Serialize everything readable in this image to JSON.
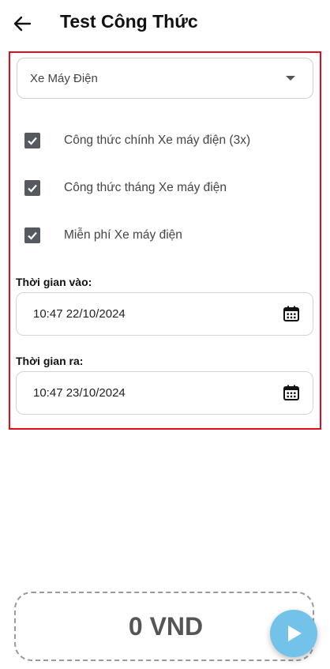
{
  "header": {
    "title": "Test Công Thức",
    "back_icon": "arrow-left-icon"
  },
  "vehicle_select": {
    "value": "Xe Máy Điện",
    "icon": "caret-down-icon"
  },
  "formulas": [
    {
      "label": "Công thức chính Xe máy điện (3x)",
      "checked": true
    },
    {
      "label": "Công thức tháng Xe máy điện",
      "checked": true
    },
    {
      "label": "Miễn phí Xe máy điện",
      "checked": true
    }
  ],
  "time_in": {
    "label": "Thời gian vào:",
    "value": "10:47 22/10/2024",
    "icon": "calendar-icon"
  },
  "time_out": {
    "label": "Thời gian ra:",
    "value": "10:47 23/10/2024",
    "icon": "calendar-icon"
  },
  "total": {
    "amount": "0 VND"
  },
  "run_button": {
    "icon": "play-icon"
  },
  "colors": {
    "panel_border": "#e10e1a",
    "checkbox": "#555a61",
    "fab": "#73c2ea"
  }
}
